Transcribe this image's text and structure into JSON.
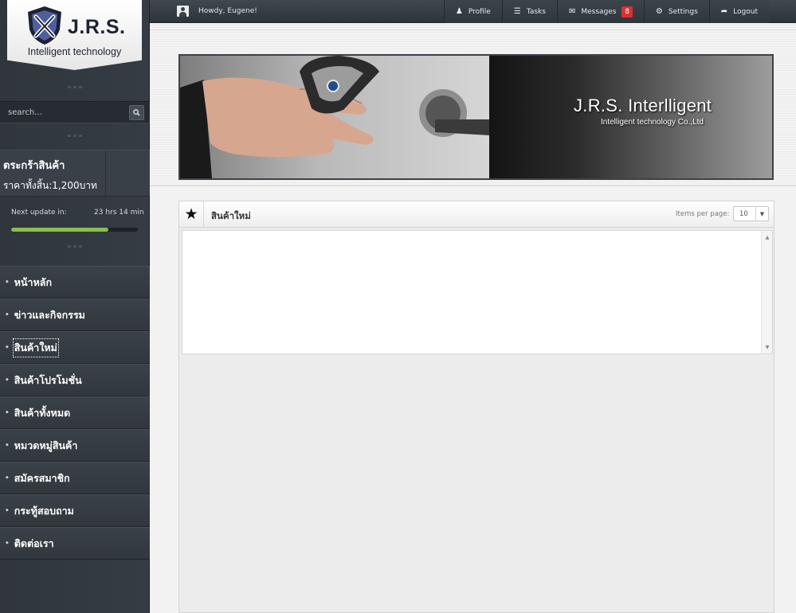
{
  "logo": {
    "name": "J.R.S.",
    "tagline": "Intelligent technology"
  },
  "search": {
    "placeholder": "search...",
    "button_icon": "search-icon"
  },
  "cart": {
    "title": "ตระกร้าสินค้า",
    "total": "ราคาทั้งสิ้น:1,200บาท"
  },
  "update": {
    "label": "Next update in:",
    "time": "23 hrs 14 min",
    "progress_percent": 77
  },
  "nav": {
    "items": [
      {
        "label": "หน้าหลัก",
        "active": false
      },
      {
        "label": "ข่าวและกิจกรรม",
        "active": false
      },
      {
        "label": "สินค้าใหม่",
        "active": true
      },
      {
        "label": "สินค้าโปรโมชั่น",
        "active": false
      },
      {
        "label": "สินค้าทั้งหมด",
        "active": false
      },
      {
        "label": "หมวดหมู่สินค้า",
        "active": false
      },
      {
        "label": "สมัครสมาชิก",
        "active": false
      },
      {
        "label": "กระทู้สอบถาม",
        "active": false
      },
      {
        "label": "ติดต่อเรา",
        "active": false
      }
    ]
  },
  "topbar": {
    "greeting": "Howdy, Eugene!",
    "profile": "Profile",
    "tasks": "Tasks",
    "messages": "Messages",
    "messages_count": "8",
    "settings": "Settings",
    "logout": "Logout"
  },
  "banner": {
    "title": "J.R.S. Interlligent",
    "subtitle": "Intelligent technology Co.,Ltd"
  },
  "panel": {
    "title": "สินค้าใหม่",
    "items_per_page_label": "Items per page:",
    "items_per_page_value": "10"
  },
  "colors": {
    "sidebar_bg": "#353c43",
    "progress_fill": "#8bbf4a",
    "badge": "#d9312f",
    "logo_navy": "#1d2233"
  }
}
